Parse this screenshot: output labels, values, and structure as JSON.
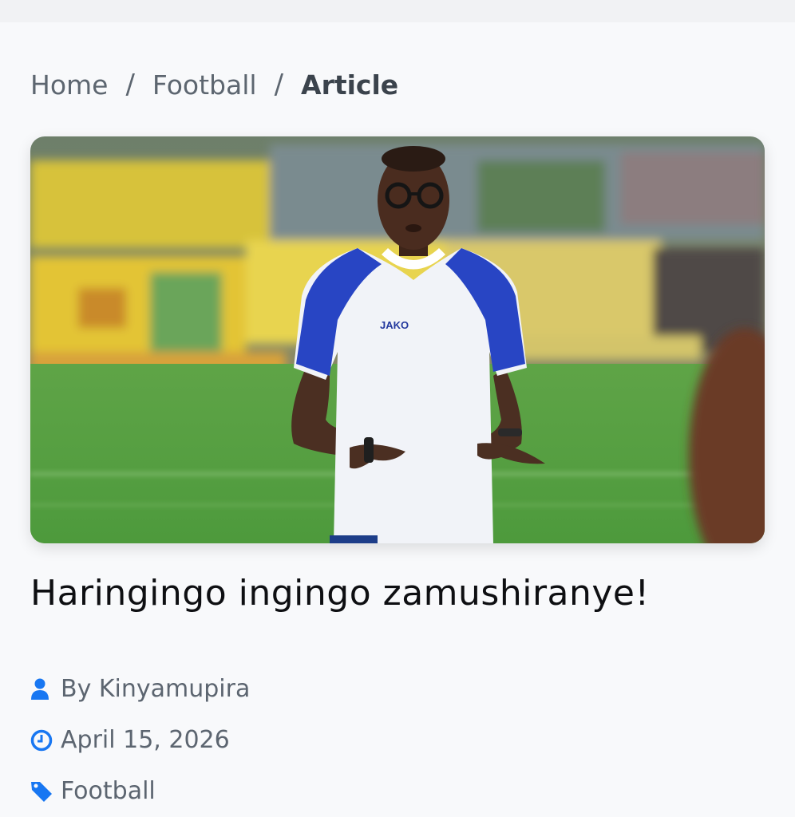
{
  "breadcrumb": {
    "home": "Home",
    "category": "Football",
    "current": "Article",
    "separator": "/"
  },
  "article": {
    "image_alt": "Coach in white and blue JAKO shirt on training pitch",
    "shirt_brand": "JAKO",
    "title": "Haringingo ingingo zamushiranye!",
    "author": "By Kinyamupira",
    "date": "April 15, 2026",
    "category": "Football"
  },
  "icons": {
    "author": "user-icon",
    "date": "clock-icon",
    "category": "tag-icon"
  },
  "colors": {
    "accent": "#1877f2",
    "title": "#0e0f12",
    "meta_text": "#5c6570"
  }
}
